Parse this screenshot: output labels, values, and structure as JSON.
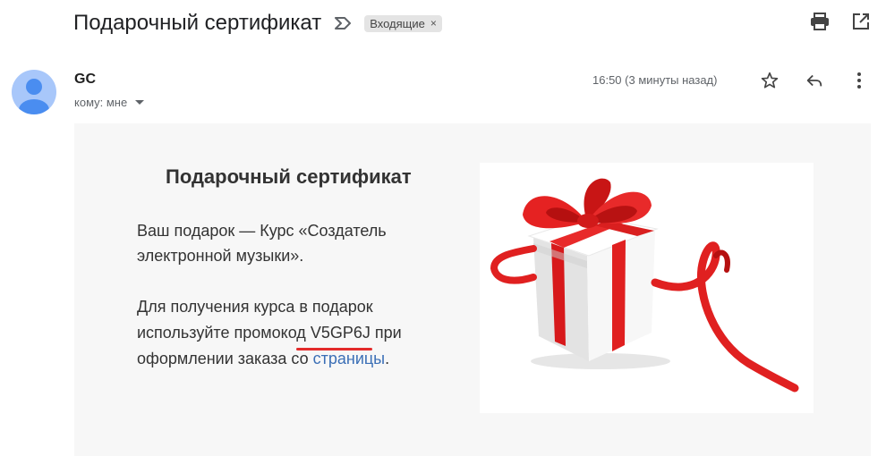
{
  "header": {
    "subject": "Подарочный сертификат",
    "label": "Входящие",
    "label_close": "×"
  },
  "sender": {
    "name": "GC",
    "to_label": "кому: мне",
    "timestamp": "16:50 (3 минуты назад)"
  },
  "body": {
    "title": "Подарочный сертификат",
    "para1": "Ваш подарок — Курс «Создатель электронной музыки».",
    "para2_start": "Для получения курса в подарок используйте промокод ",
    "promo_code": "V5GP6J",
    "para2_mid": " при оформлении заказа со ",
    "link_text": "страницы",
    "para2_end": "."
  },
  "icons": {
    "importance": "importance-marker-icon",
    "print": "print-icon",
    "open_new_window": "open-in-new-window-icon",
    "star": "star-icon",
    "reply": "reply-icon",
    "more": "more-vert-icon"
  },
  "colors": {
    "avatar": "#a8c7fa",
    "avatar_figure": "#4a8df0",
    "promo_underline": "#e32b2b",
    "link": "#3b6fb6",
    "body_bg": "#f7f7f7"
  }
}
